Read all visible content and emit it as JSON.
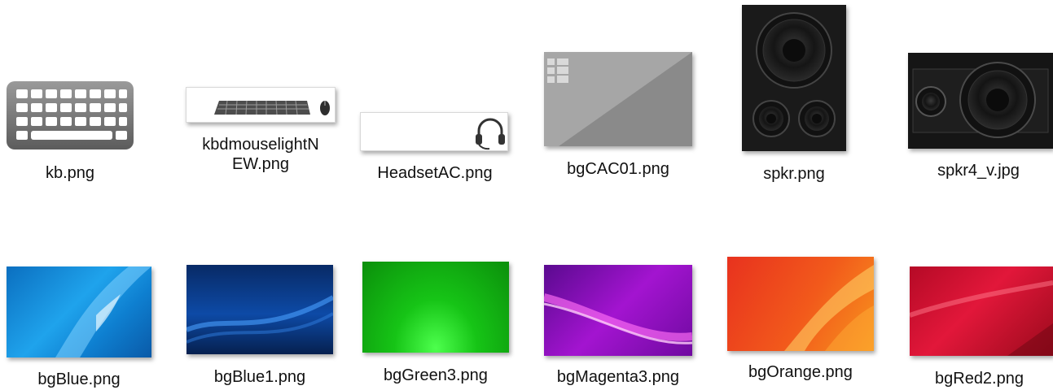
{
  "files": [
    {
      "name": "kb.png",
      "icon": "keyboard-icon"
    },
    {
      "name_line1": "kbdmouselightN",
      "name_line2": "EW.png",
      "icon": "keyboard-mouse-icon"
    },
    {
      "name": "HeadsetAC.png",
      "icon": "headset-icon"
    },
    {
      "name": "bgCAC01.png",
      "icon": "smart-card-icon"
    },
    {
      "name": "spkr.png",
      "icon": "speaker-icon"
    },
    {
      "name": "spkr4_v.jpg",
      "icon": "speaker-horizontal-icon"
    },
    {
      "name": "bgBlue.png",
      "color": "#1b8fd6"
    },
    {
      "name": "bgBlue1.png",
      "color": "#0d3f8c"
    },
    {
      "name": "bgGreen3.png",
      "color": "#16c416"
    },
    {
      "name": "bgMagenta3.png",
      "color": "#a314d0"
    },
    {
      "name": "bgOrange.png",
      "color": "#f0471d"
    },
    {
      "name": "bgRed2.png",
      "color": "#d5112e"
    }
  ]
}
